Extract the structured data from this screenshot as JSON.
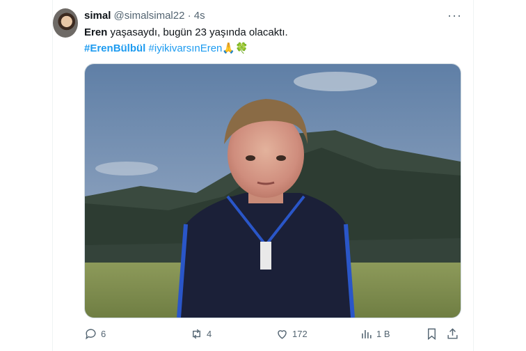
{
  "tweet": {
    "name": "simal",
    "handle": "@simalsimal22",
    "separator": "·",
    "time": "4s",
    "more_label": "···",
    "text_name": "Eren",
    "text_rest": " yaşasaydı, bugün 23 yaşında olacaktı.",
    "hashtag1": "#ErenBülbül",
    "hashtag2": "#iyikivarsınEren",
    "emoji": "🙏🍀"
  },
  "actions": {
    "replies": "6",
    "reposts": "4",
    "likes": "172",
    "views": "1 B"
  },
  "icons": [
    "reply-icon",
    "repost-icon",
    "like-icon",
    "views-icon",
    "bookmark-icon",
    "share-icon"
  ],
  "colors": {
    "accent": "#1d9bf0",
    "muted": "#536471",
    "text": "#0f1419"
  }
}
